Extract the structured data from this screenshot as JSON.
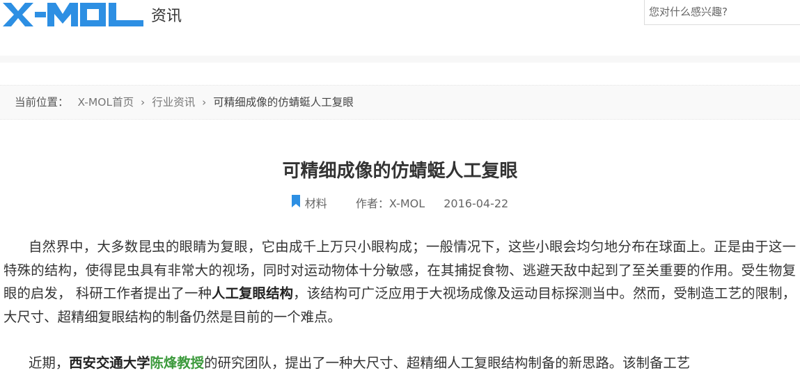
{
  "header": {
    "logo_text": "X-MOL",
    "section_label": "资讯",
    "search_placeholder": "您对什么感兴趣?"
  },
  "colors": {
    "logo_blue": "#2d8fe3",
    "bookmark_blue": "#2d8fe3",
    "highlight_green": "#3c9a3c"
  },
  "breadcrumb": {
    "prefix": "当前位置：",
    "home": "X-MOL首页",
    "separator": "›",
    "category": "行业资讯",
    "current": "可精细成像的仿蜻蜓人工复眼"
  },
  "article": {
    "title": "可精细成像的仿蜻蜓人工复眼",
    "meta": {
      "category_icon": "bookmark-icon",
      "category": "材料",
      "author": "作者：X-MOL",
      "date": "2016-04-22"
    },
    "p1": {
      "before": "自然界中，大多数昆虫的眼睛为复眼，它由成千上万只小眼构成；一般情况下，这些小眼会均匀地分布在球面上。正是由于这一特殊的结构，使得昆虫具有非常大的视场，同时对运动物体十分敏感，在其捕捉食物、逃避天敌中起到了至关重要的作用。受生物复眼的启发， 科研工作者提出了一种",
      "bold": "人工复眼结构",
      "after": "，该结构可广泛应用于大视场成像及运动目标探测当中。然而，受制造工艺的限制，大尺寸、超精细复眼结构的制备仍然是目前的一个难点。"
    },
    "p2": {
      "before": "近期，",
      "bold": "西安交通大学",
      "green": "陈烽教授",
      "after": "的研究团队，提出了一种大尺寸、超精细人工复眼结构制备的新思路。该制备工艺"
    }
  }
}
